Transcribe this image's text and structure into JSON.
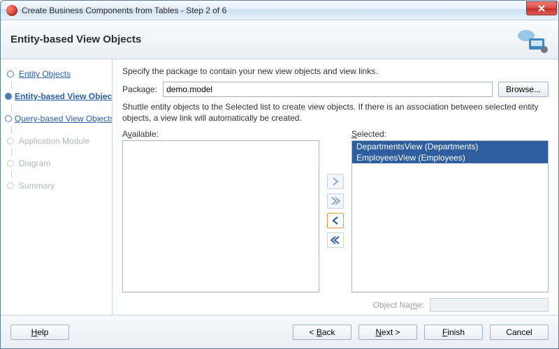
{
  "window": {
    "title": "Create Business Components from Tables - Step 2 of 6"
  },
  "header": {
    "title": "Entity-based View Objects"
  },
  "sidebar": {
    "steps": [
      {
        "label": "Entity Objects"
      },
      {
        "label": "Entity-based View Objects"
      },
      {
        "label": "Query-based View Objects"
      },
      {
        "label": "Application Module"
      },
      {
        "label": "Diagram"
      },
      {
        "label": "Summary"
      }
    ]
  },
  "main": {
    "instruction1": "Specify the package to contain your new view objects and view links.",
    "package_label_pre": "P",
    "package_label_ul": "a",
    "package_label_post": "ckage:",
    "package_value": "demo.model",
    "browse_label_pre": "Br",
    "browse_label_ul": "o",
    "browse_label_post": "wse...",
    "instruction2": "Shuttle entity objects to the Selected list to create view objects.  If there is an association between selected entity objects, a view link will automatically be created.",
    "available_label_pre": "A",
    "available_label_ul": "v",
    "available_label_post": "ailable:",
    "selected_label_pre": "",
    "selected_label_ul": "S",
    "selected_label_post": "elected:",
    "selected_items": [
      "DepartmentsView (Departments)",
      "EmployeesView (Employees)"
    ],
    "object_name_label_pre": "Object Na",
    "object_name_label_ul": "m",
    "object_name_label_post": "e:"
  },
  "footer": {
    "help_ul": "H",
    "help_post": "elp",
    "back_pre": "< ",
    "back_ul": "B",
    "back_post": "ack",
    "next_ul": "N",
    "next_post": "ext >",
    "finish_ul": "F",
    "finish_post": "inish",
    "cancel": "Cancel"
  }
}
